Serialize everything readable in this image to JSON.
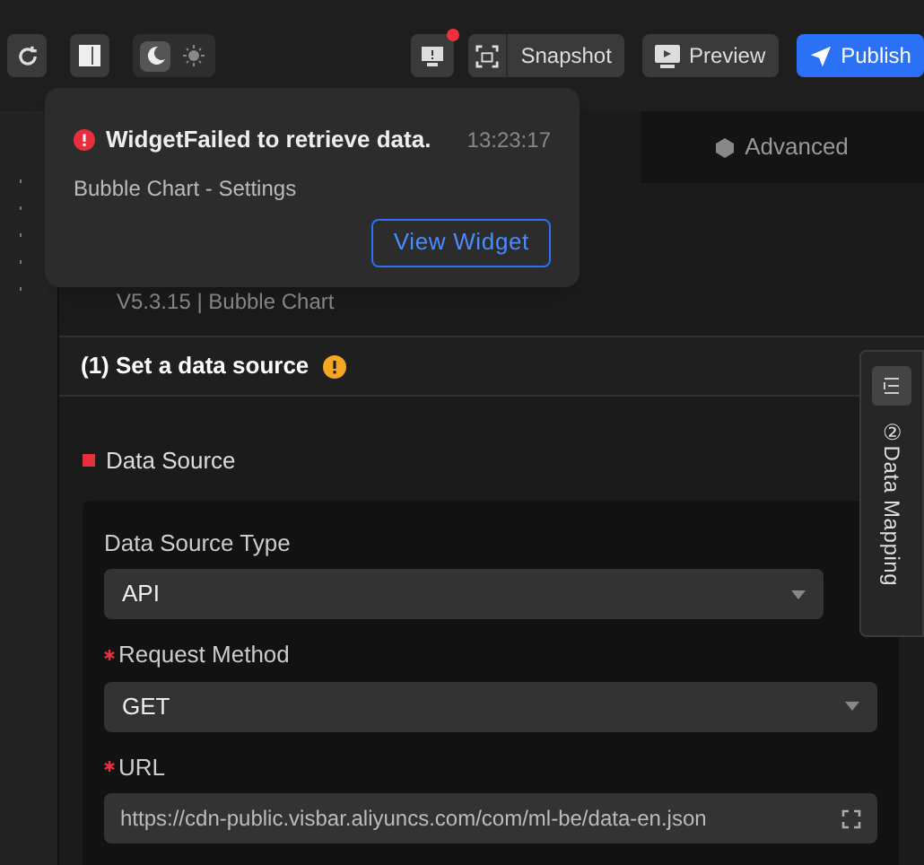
{
  "toolbar": {
    "left_buttons": [
      {
        "kind": "refresh"
      },
      {
        "kind": "layout"
      }
    ],
    "theme_toggle": [
      {
        "kind": "dark",
        "selected": true
      },
      {
        "kind": "light",
        "selected": false
      }
    ],
    "alert_button": {
      "unread": true
    },
    "actions": [
      {
        "kind": "snapshot",
        "label": "Snapshot"
      },
      {
        "kind": "preview",
        "label": "Preview"
      },
      {
        "kind": "publish",
        "label": "Publish"
      }
    ]
  },
  "notification": {
    "title": "WidgetFailed to retrieve data.",
    "time": "13:23:17",
    "subtitle": "Bubble Chart - Settings",
    "action": "View Widget"
  },
  "tabs": [
    {
      "label": "Advanced",
      "selected": false
    }
  ],
  "version": "V5.3.15 | Bubble Chart",
  "section": {
    "title": "(1) Set a data source",
    "warning": true
  },
  "side_tab": {
    "label": "②Data Mapping"
  },
  "group": {
    "title": "Data Source",
    "fields": [
      {
        "kind": "select",
        "label": "Data Source Type",
        "required": false,
        "value": "API"
      },
      {
        "kind": "select",
        "label": "Request Method",
        "required": true,
        "value": "GET"
      },
      {
        "kind": "text",
        "label": "URL",
        "required": true,
        "value": "https://cdn-public.visbar.aliyuncs.com/com/ml-be/data-en.json"
      }
    ]
  }
}
